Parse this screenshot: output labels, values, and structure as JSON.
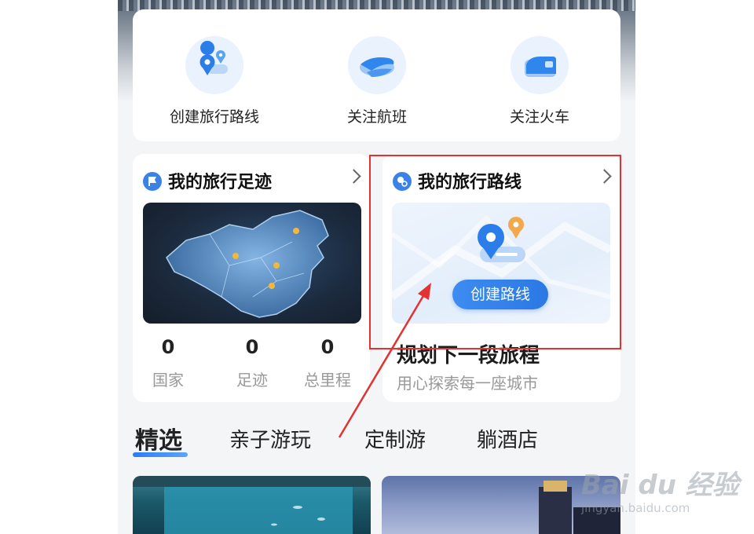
{
  "quick_actions": [
    {
      "label": "创建旅行路线",
      "icon": "route-pin-icon"
    },
    {
      "label": "关注航班",
      "icon": "airplane-icon"
    },
    {
      "label": "关注火车",
      "icon": "train-icon"
    }
  ],
  "footprint_card": {
    "title": "我的旅行足迹",
    "stats": [
      {
        "value": "0",
        "label": "国家"
      },
      {
        "value": "0",
        "label": "足迹"
      },
      {
        "value": "0",
        "label": "总里程"
      }
    ]
  },
  "route_card": {
    "title": "我的旅行路线",
    "button": "创建路线",
    "headline": "规划下一段旅程",
    "subtitle": "用心探索每一座城市"
  },
  "tabs": [
    "精选",
    "亲子游玩",
    "定制游",
    "躺酒店"
  ],
  "watermark": {
    "logo_text": "Bai du 经验",
    "url": "jingyan.baidu.com"
  },
  "colors": {
    "accent": "#2b78e4",
    "annotation": "#e23232"
  }
}
